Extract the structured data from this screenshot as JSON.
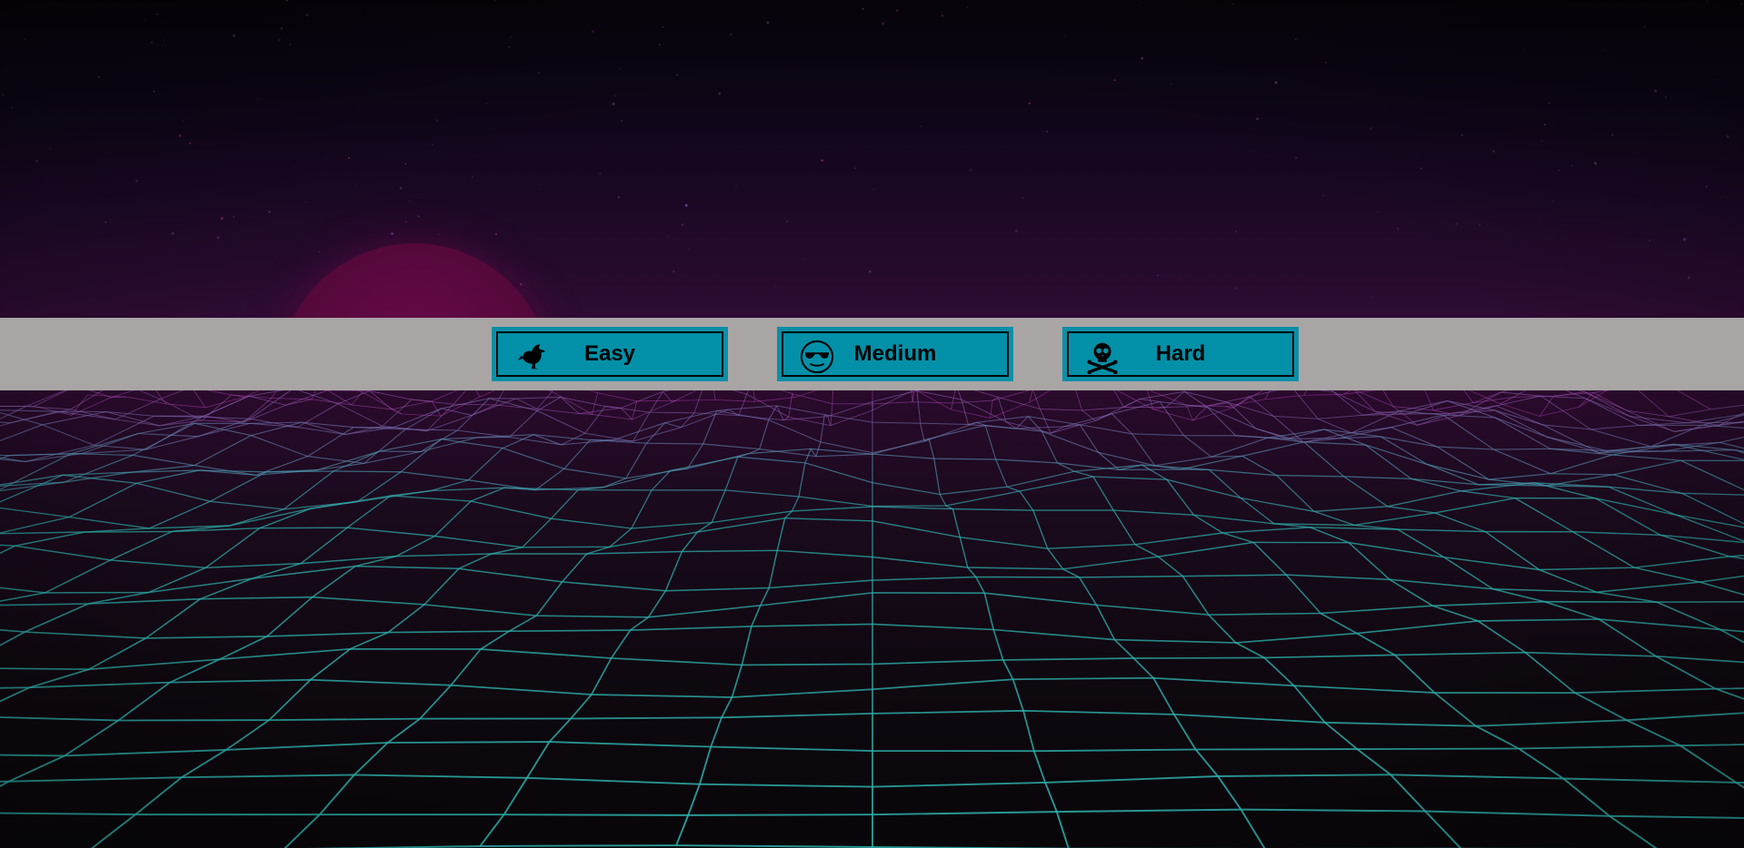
{
  "menu": {
    "buttons": [
      {
        "label": "Easy",
        "icon": "bird-icon"
      },
      {
        "label": "Medium",
        "icon": "sunglasses-face-icon"
      },
      {
        "label": "Hard",
        "icon": "skull-crossbones-icon"
      }
    ]
  },
  "colors": {
    "button_bg": "#0190a8",
    "menu_bar_bg": "#a9a5a5",
    "grid_near": "#2fb4b0",
    "grid_far": "#b03cb0",
    "sun": "#5a0840"
  }
}
